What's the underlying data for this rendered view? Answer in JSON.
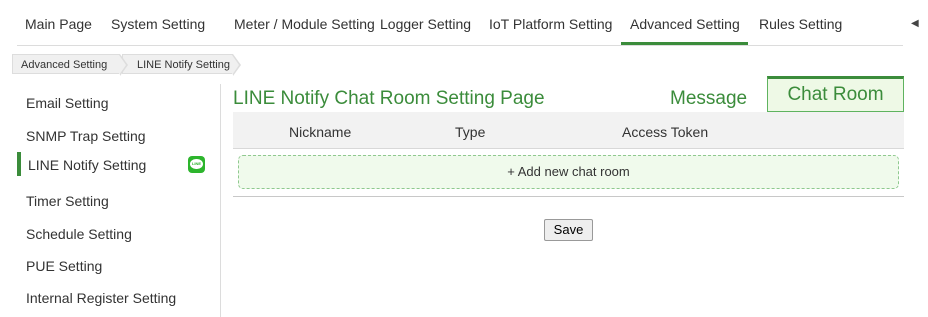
{
  "topnav": {
    "items": [
      {
        "label": "Main Page"
      },
      {
        "label": "System Setting"
      },
      {
        "label": "Meter / Module Setting"
      },
      {
        "label": "Logger Setting"
      },
      {
        "label": "IoT Platform Setting"
      },
      {
        "label": "Advanced Setting",
        "active": true
      },
      {
        "label": "Rules Setting"
      }
    ],
    "scroll_arrow": "◀"
  },
  "breadcrumb": [
    "Advanced Setting",
    "LINE Notify Setting"
  ],
  "sidebar": {
    "items": [
      {
        "label": "Email Setting"
      },
      {
        "label": "SNMP Trap Setting"
      },
      {
        "label": "LINE Notify Setting",
        "active": true,
        "icon": "line-app-icon",
        "icon_text": "LINE"
      },
      {
        "label": "Timer Setting"
      },
      {
        "label": "Schedule Setting"
      },
      {
        "label": "PUE Setting"
      },
      {
        "label": "Internal Register Setting"
      }
    ]
  },
  "main": {
    "title": "LINE Notify Chat Room Setting Page",
    "tabs": [
      {
        "label": "Message"
      },
      {
        "label": "Chat Room",
        "active": true
      }
    ],
    "table": {
      "columns": [
        "Nickname",
        "Type",
        "Access Token"
      ],
      "add_row_label": "+ Add new chat room"
    },
    "save_label": "Save"
  },
  "colors": {
    "accent": "#3b8c3b",
    "active_tab_bg": "#eef9e6",
    "line_icon": "#2db52d"
  }
}
